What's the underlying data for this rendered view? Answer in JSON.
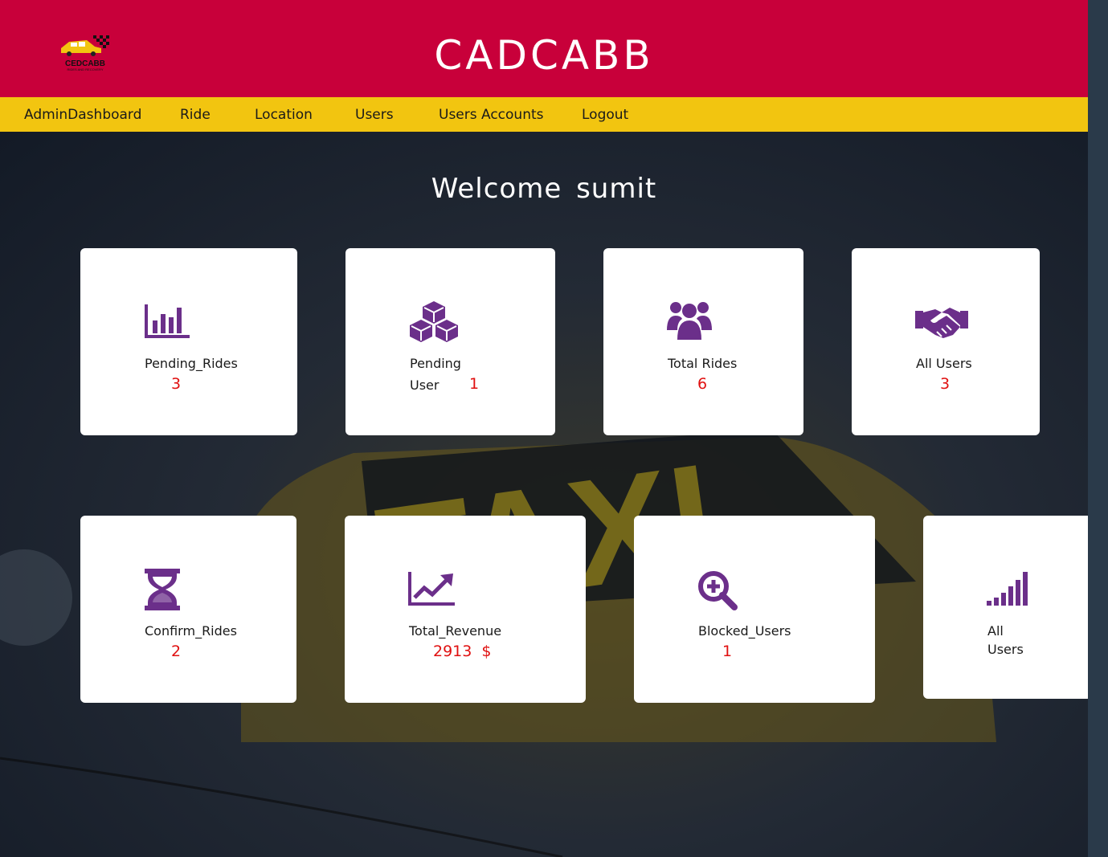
{
  "header": {
    "title": "CADCABB",
    "logo_text": "CEDCABB",
    "logo_subtext": "RIDES AND RECOVERY"
  },
  "nav": {
    "items": [
      "AdminDashboard",
      "Ride",
      "Location",
      "Users",
      "Users Accounts",
      "Logout"
    ]
  },
  "welcome": "Welcome  sumit",
  "background_text": "TAXI",
  "icon_color": "#6b2f8a",
  "cards": [
    {
      "label": "Pending_Rides",
      "value": "3",
      "icon": "bar-chart-icon"
    },
    {
      "label_line1": "Pending",
      "label_line2": "User",
      "value": "1",
      "icon": "cubes-icon"
    },
    {
      "label": "Total Rides",
      "value": "6",
      "icon": "users-group-icon"
    },
    {
      "label": "All Users",
      "value": "3",
      "icon": "handshake-icon"
    },
    {
      "label": "Confirm_Rides",
      "value": "2",
      "icon": "hourglass-icon"
    },
    {
      "label": "Total_Revenue",
      "value": "2913  $",
      "icon": "line-chart-icon"
    },
    {
      "label": "Blocked_Users",
      "value": "1",
      "icon": "search-plus-icon"
    },
    {
      "label_line1": "All",
      "label_line2": "Users",
      "icon": "signal-icon"
    }
  ]
}
